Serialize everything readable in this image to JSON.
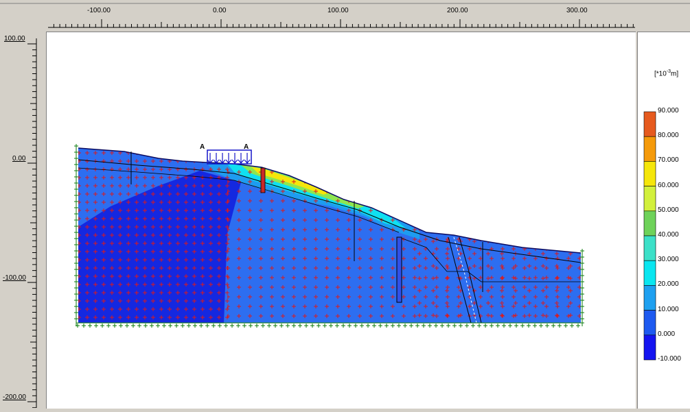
{
  "rulers": {
    "horizontal_ticks": [
      "-100.00",
      "0.00",
      "100.00",
      "200.00",
      "300.00"
    ],
    "vertical_ticks": [
      "100.00",
      "0.00",
      "-100.00",
      "-200.00"
    ]
  },
  "model": {
    "load_label_left": "A",
    "load_label_right": "A"
  },
  "legend": {
    "unit": "[*10",
    "unit_exp": "-3",
    "unit_suffix": "m]",
    "entries": [
      {
        "label": "90.000",
        "color": "#e65a1e"
      },
      {
        "label": "80.000",
        "color": "#f59a0a"
      },
      {
        "label": "70.000",
        "color": "#f5e60a"
      },
      {
        "label": "60.000",
        "color": "#d2f03c"
      },
      {
        "label": "50.000",
        "color": "#6ed25a"
      },
      {
        "label": "40.000",
        "color": "#3ce0c8"
      },
      {
        "label": "30.000",
        "color": "#0ae6f0"
      },
      {
        "label": "20.000",
        "color": "#1ea0f0"
      },
      {
        "label": "10.000",
        "color": "#1e5af0"
      },
      {
        "label": "0.000",
        "color": "#1414f0"
      },
      {
        "label": "-10.000",
        "color": ""
      }
    ]
  }
}
